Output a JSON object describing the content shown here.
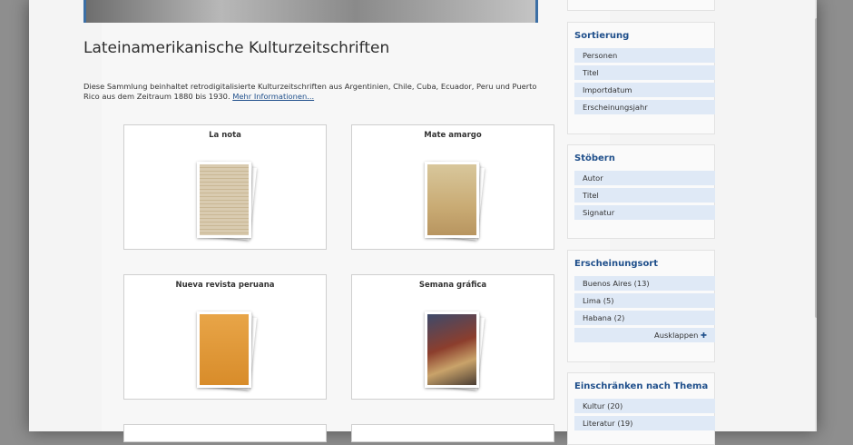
{
  "page": {
    "title": "Lateinamerikanische Kulturzeitschriften",
    "intro": "Diese Sammlung beinhaltet retrodigitalisierte Kulturzeitschriften aus Argentinien, Chile, Cuba, Ecuador, Peru und Puerto Rico aus dem Zeitraum 1880 bis 1930.",
    "more_link": "Mehr Informationen..."
  },
  "cards": [
    {
      "title": "La nota",
      "cover_icon": "magazine-cover-la-nota"
    },
    {
      "title": "Mate amargo",
      "cover_icon": "magazine-cover-mate-amargo"
    },
    {
      "title": "Nueva revista peruana",
      "cover_icon": "magazine-cover-nueva-revista-peruana"
    },
    {
      "title": "Semana gráfica",
      "cover_icon": "magazine-cover-semana-grafica"
    }
  ],
  "sidebar": {
    "sort": {
      "heading": "Sortierung",
      "items": [
        "Personen",
        "Titel",
        "Importdatum",
        "Erscheinungsjahr"
      ]
    },
    "browse": {
      "heading": "Stöbern",
      "items": [
        "Autor",
        "Titel",
        "Signatur"
      ]
    },
    "place": {
      "heading": "Erscheinungsort",
      "items": [
        "Buenos Aires (13)",
        "Lima (5)",
        "Habana (2)"
      ],
      "expand": "Ausklappen",
      "expand_icon": "plus-icon"
    },
    "topic": {
      "heading": "Einschränken nach Thema",
      "items": [
        "Kultur (20)",
        "Literatur (19)"
      ]
    }
  },
  "colors": {
    "link": "#1f4f8b",
    "item_bg": "#dfe9f6",
    "accent_border": "#3c6fa5"
  }
}
